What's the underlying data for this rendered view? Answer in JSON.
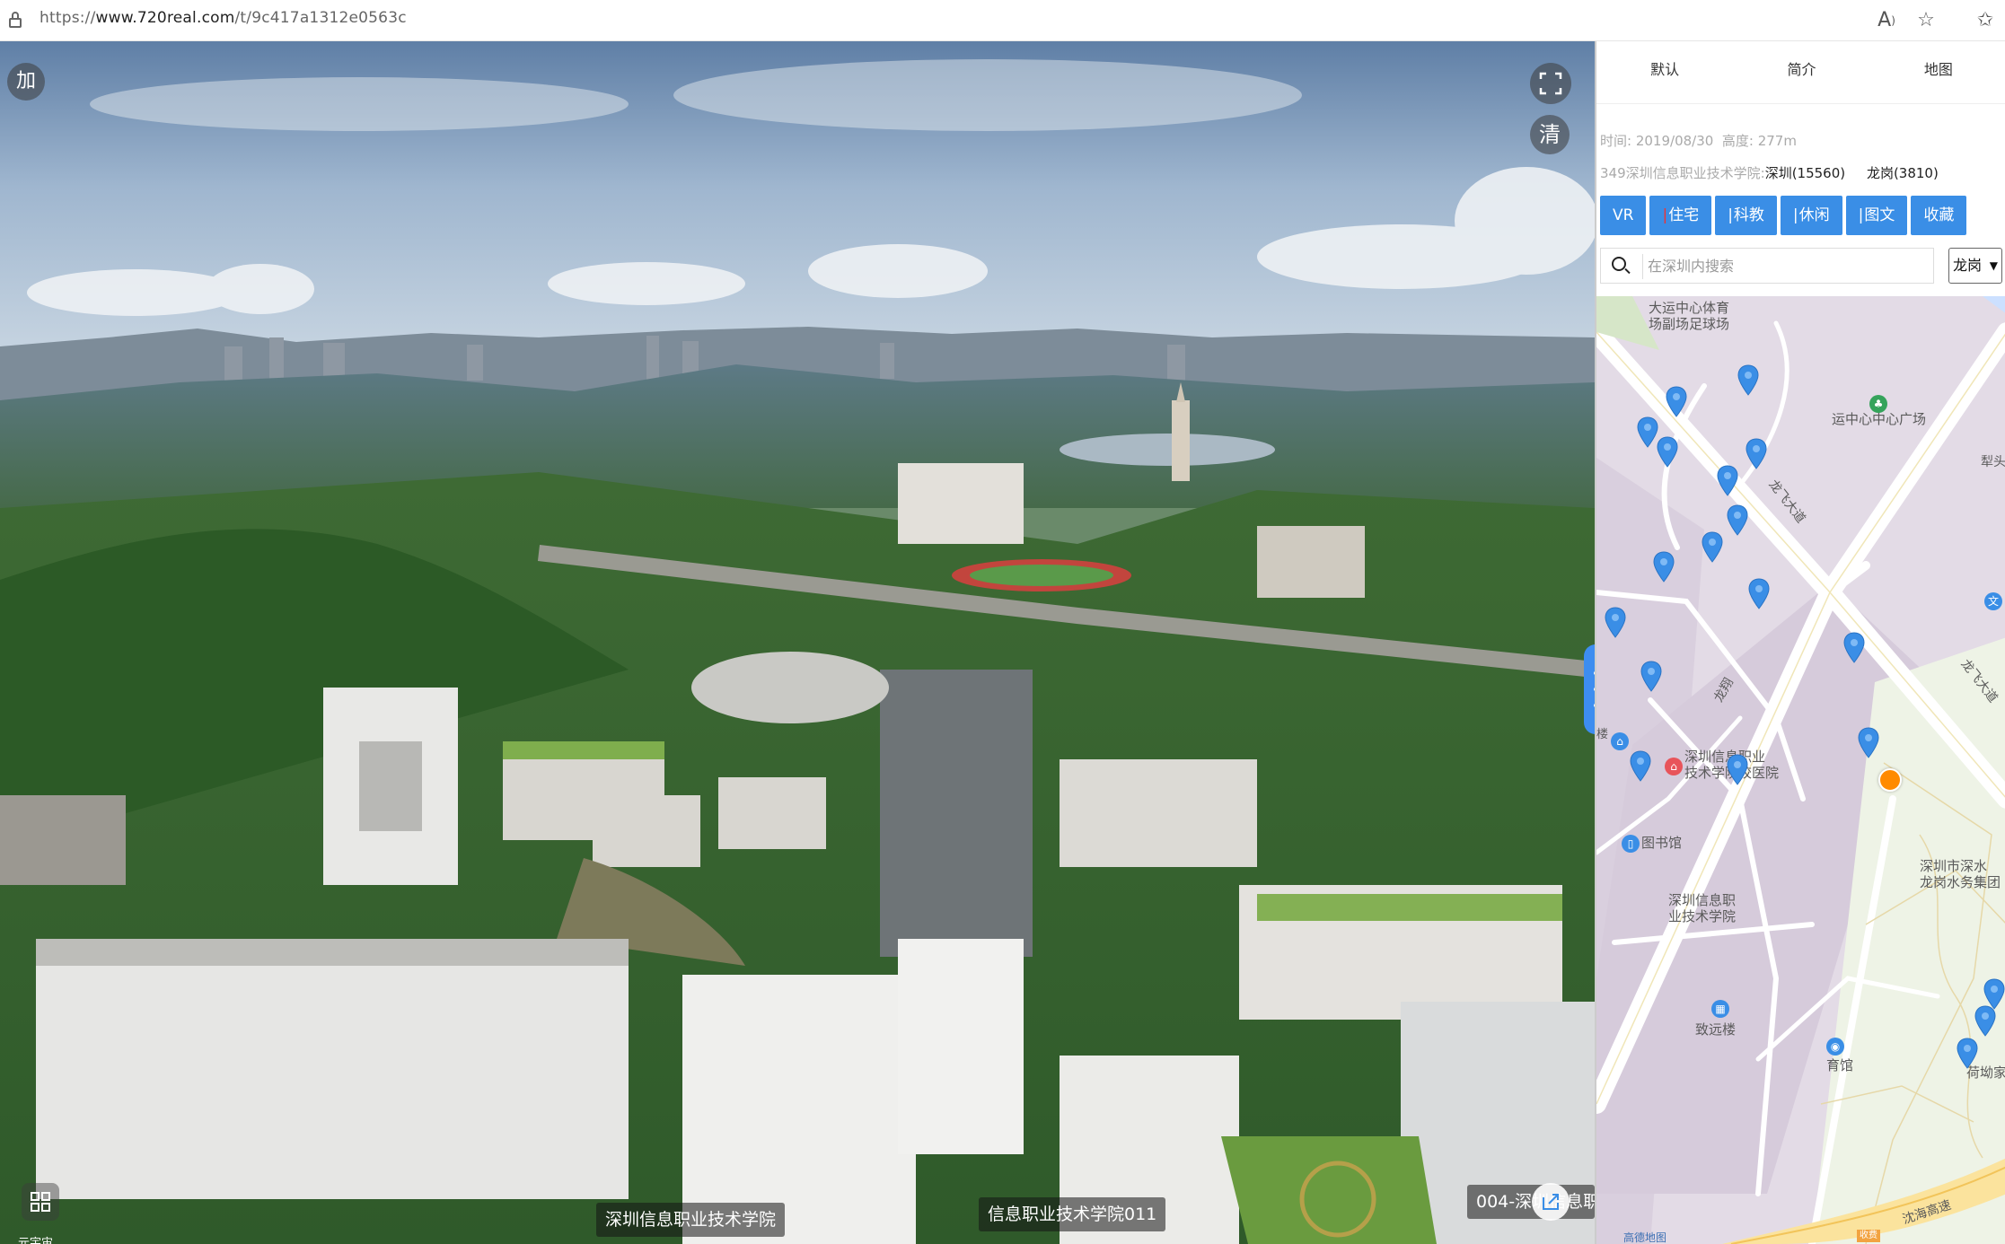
{
  "browser": {
    "url_prefix": "https://",
    "url_host": "www.720real.com",
    "url_path": "/t/9c417a1312e0563c",
    "icons": [
      "lock-icon",
      "read-aloud-icon",
      "add-favorite-icon",
      "favorites-icon"
    ]
  },
  "pano": {
    "add_button": "加",
    "clear_button": "清",
    "scene_labels": [
      "深圳信息职业技术学院",
      "信息职业技术学院011",
      "004-深圳信息职"
    ],
    "bottom_left_caption": "元宇宙"
  },
  "side": {
    "tabs": [
      "默认",
      "简介",
      "地图"
    ],
    "info": {
      "time_label": "时间:",
      "time_value": "2019/08/30",
      "height_label": "高度:",
      "height_value": "277m",
      "place_prefix": "349深圳信息职业技术学院:",
      "city": "深圳(15560)",
      "district": "龙岗(3810)"
    },
    "categories": [
      {
        "label": "VR",
        "bar": ""
      },
      {
        "label": "住宅",
        "bar": "|"
      },
      {
        "label": "科教",
        "bar": "|"
      },
      {
        "label": "休闲",
        "bar": "|"
      },
      {
        "label": "图文",
        "bar": "|"
      },
      {
        "label": "收藏",
        "bar": ""
      }
    ],
    "search_placeholder": "在深圳内搜索",
    "district_select": "龙岗"
  },
  "map": {
    "labels": {
      "sports_park": "大运中心体育",
      "sports_park_2": "场副场足球场",
      "plaza": "运中心中心广场",
      "road_longfei": "龙飞大道",
      "road_longfei_2": "龙飞大道",
      "road_longxiang": "龙翔",
      "hospital": "深圳信息职业",
      "hospital_2": "技术学院校医院",
      "library": "图书馆",
      "college": "深圳信息职",
      "college_2": "业技术学院",
      "water_group": "深圳市深水",
      "water_group_2": "龙岗水务集团",
      "zhiyuan": "致远楼",
      "gym": "育馆",
      "hehe": "荷坳家",
      "li": "犁头",
      "expressway": "沈海高速",
      "toll": "收费",
      "attribution": "高德地图",
      "building": "楼"
    }
  }
}
